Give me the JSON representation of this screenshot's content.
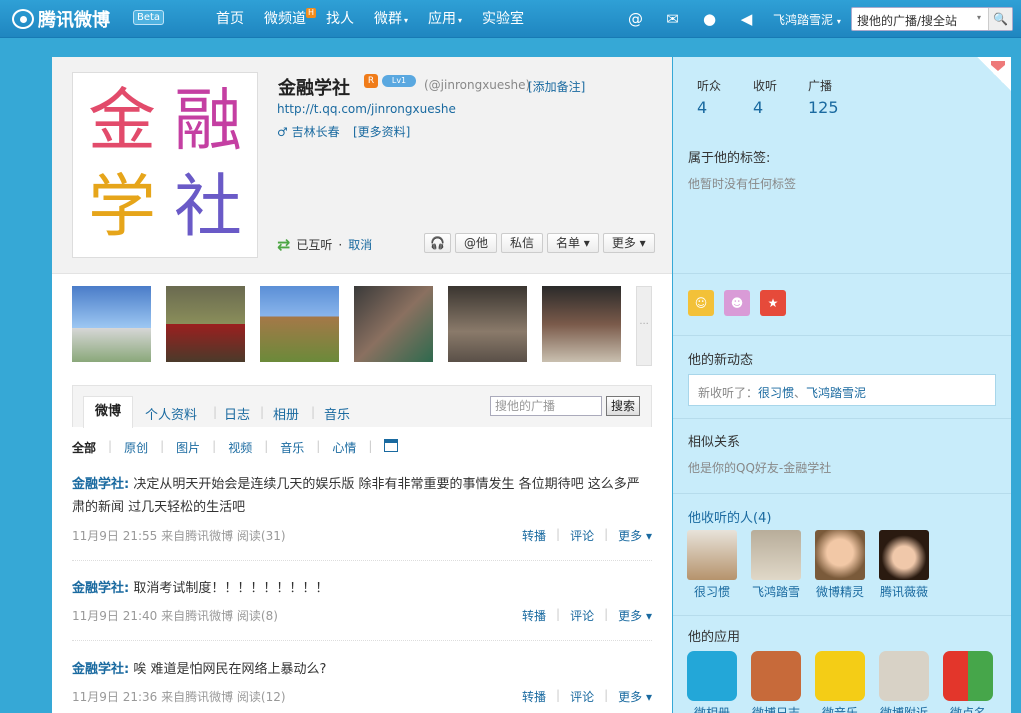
{
  "topbar": {
    "logo": "腾讯微博",
    "beta": "Beta",
    "nav": [
      {
        "label": "首页"
      },
      {
        "label": "微频道",
        "badge": "H"
      },
      {
        "label": "找人"
      },
      {
        "label": "微群",
        "caret": "▾"
      },
      {
        "label": "应用",
        "caret": "▾"
      },
      {
        "label": "实验室"
      }
    ],
    "icons": [
      "at-icon",
      "mail-icon",
      "user-icon",
      "speaker-icon"
    ],
    "username": "飞鸿踏雪泥",
    "username_caret": "▾",
    "search_scope": "搜他的广播/搜全站",
    "search_caret": "▾"
  },
  "profile": {
    "avatar_chars": [
      "金",
      "融",
      "学",
      "社"
    ],
    "name": "金融学社",
    "badge_text": "R",
    "level_text": "Lv1",
    "handle": "(@jinrongxueshe)",
    "add_note": "[添加备注]",
    "url": "http://t.qq.com/jinrongxueshe",
    "location": "♂ 吉林长春",
    "more_info": "[更多资料]",
    "mutual": "已互听",
    "cancel": "取消",
    "actions": [
      {
        "label": "@他"
      },
      {
        "label": "私信"
      },
      {
        "label": "名单 ▾"
      },
      {
        "label": "更多 ▾"
      }
    ],
    "more_photos": "···"
  },
  "tabs": {
    "items": [
      "微博",
      "个人资料",
      "日志",
      "相册",
      "音乐"
    ],
    "search_placeholder": "搜他的广播",
    "search_button": "搜索"
  },
  "filters": [
    "全部",
    "原创",
    "图片",
    "视频",
    "音乐",
    "心情"
  ],
  "posts": [
    {
      "author": "金融学社:",
      "text": " 决定从明天开始会是连续几天的娱乐版 除非有非常重要的事情发生 各位期待吧 这么多严肃的新闻 过几天轻松的生活吧",
      "meta": "11月9日 21:55 来自腾讯微博 阅读(31)"
    },
    {
      "author": "金融学社:",
      "text": " 取消考试制度！！！！！！！！！",
      "meta": "11月9日 21:40 来自腾讯微博 阅读(8)"
    },
    {
      "author": "金融学社:",
      "text": " 唉 难道是怕网民在网络上暴动么?",
      "meta": "11月9日 21:36 来自腾讯微博 阅读(12)"
    }
  ],
  "post_actions": {
    "forward": "转播",
    "comment": "评论",
    "more": "更多 ▾",
    "sep": "|"
  },
  "side": {
    "stats": [
      {
        "label": "听众",
        "value": "4"
      },
      {
        "label": "收听",
        "value": "4"
      },
      {
        "label": "广播",
        "value": "125"
      }
    ],
    "tags_title": "属于他的标签:",
    "tags_empty": "他暂时没有任何标签",
    "medals": [
      "medal-gold",
      "medal-pink",
      "medal-red"
    ],
    "news_title": "他的新动态",
    "news_prefix": "新收听了：",
    "news_link1": "很习惯",
    "news_sep": "、",
    "news_link2": "飞鸿踏雪泥",
    "similar_title": "相似关系",
    "similar_text": "他是你的QQ好友-金融学社",
    "following_title": "他收听的人(4)",
    "following": [
      "很习惯",
      "飞鸿踏雪",
      "微博精灵",
      "腾讯薇薇"
    ],
    "apps_title": "他的应用",
    "apps": [
      "微相册",
      "微博日志",
      "微音乐",
      "微博附近",
      "微点名"
    ]
  }
}
